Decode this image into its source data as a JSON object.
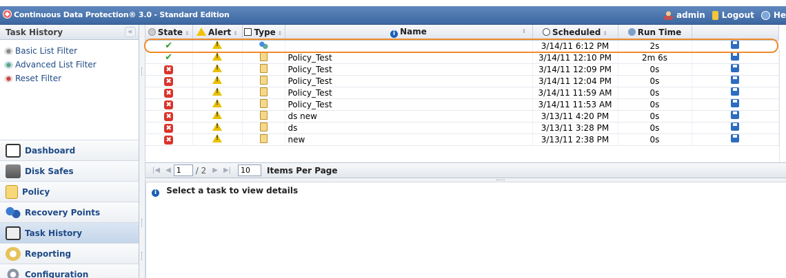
{
  "app": {
    "title": "Continuous Data Protection® 3.0 - Standard Edition",
    "user": "admin",
    "logout_label": "Logout",
    "help_label": "He"
  },
  "left_panel": {
    "title": "Task History",
    "collapse_glyph": "«",
    "filters": [
      {
        "label": "Basic List Filter",
        "icon": "filter-icon"
      },
      {
        "label": "Advanced List Filter",
        "icon": "advanced-filter-icon"
      },
      {
        "label": "Reset Filter",
        "icon": "reset-filter-icon"
      }
    ]
  },
  "nav": {
    "items": [
      {
        "label": "Dashboard",
        "icon": "dashboard-icon",
        "active": false
      },
      {
        "label": "Disk Safes",
        "icon": "disk-safe-icon",
        "active": false
      },
      {
        "label": "Policy",
        "icon": "policy-icon",
        "active": false
      },
      {
        "label": "Recovery Points",
        "icon": "recovery-points-icon",
        "active": false
      },
      {
        "label": "Task History",
        "icon": "task-history-icon",
        "active": true
      },
      {
        "label": "Reporting",
        "icon": "reporting-icon",
        "active": false
      },
      {
        "label": "Configuration",
        "icon": "configuration-icon",
        "active": false
      }
    ]
  },
  "grid": {
    "columns": {
      "state": "State",
      "alert": "Alert",
      "type": "Type",
      "name": "Name",
      "scheduled": "Scheduled",
      "run_time": "Run Time"
    },
    "rows": [
      {
        "state": "success",
        "alert": "warning",
        "type": "scheduled",
        "name": "",
        "scheduled": "3/14/11 6:12 PM",
        "run_time": "2s"
      },
      {
        "state": "success",
        "alert": "warning",
        "type": "policy",
        "name": "Policy_Test",
        "scheduled": "3/14/11 12:10 PM",
        "run_time": "2m 6s"
      },
      {
        "state": "error",
        "alert": "warning",
        "type": "policy",
        "name": "Policy_Test",
        "scheduled": "3/14/11 12:09 PM",
        "run_time": "0s"
      },
      {
        "state": "error",
        "alert": "warning",
        "type": "policy",
        "name": "Policy_Test",
        "scheduled": "3/14/11 12:04 PM",
        "run_time": "0s"
      },
      {
        "state": "error",
        "alert": "warning",
        "type": "policy",
        "name": "Policy_Test",
        "scheduled": "3/14/11 11:59 AM",
        "run_time": "0s"
      },
      {
        "state": "error",
        "alert": "warning",
        "type": "policy",
        "name": "Policy_Test",
        "scheduled": "3/14/11 11:53 AM",
        "run_time": "0s"
      },
      {
        "state": "error",
        "alert": "warning",
        "type": "policy",
        "name": "ds new",
        "scheduled": "3/13/11 4:20 PM",
        "run_time": "0s"
      },
      {
        "state": "error",
        "alert": "warning",
        "type": "policy",
        "name": "ds",
        "scheduled": "3/13/11 3:28 PM",
        "run_time": "0s"
      },
      {
        "state": "error",
        "alert": "warning",
        "type": "policy",
        "name": "new",
        "scheduled": "3/13/11 2:38 PM",
        "run_time": "0s"
      }
    ]
  },
  "pager": {
    "current_page": "1",
    "of_pages": "/ 2",
    "items_per_page_value": "10",
    "items_per_page_label": "Items Per Page"
  },
  "details": {
    "message": "Select a task to view details"
  }
}
